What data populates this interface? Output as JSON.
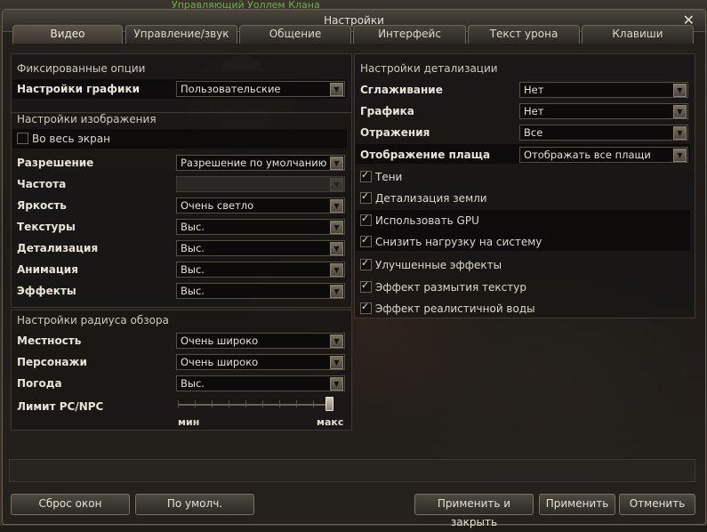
{
  "window": {
    "title": "Настройки",
    "background_caption": "Управляющий Уоллем Клана"
  },
  "tabs": [
    {
      "label": "Видео",
      "active": true
    },
    {
      "label": "Управление/звук",
      "active": false
    },
    {
      "label": "Общение",
      "active": false
    },
    {
      "label": "Интерфейс",
      "active": false
    },
    {
      "label": "Текст урона",
      "active": false
    },
    {
      "label": "Клавиши",
      "active": false
    }
  ],
  "left": {
    "fixed": {
      "title": "Фиксированные опции",
      "graphics_label": "Настройки графики",
      "graphics_value": "Пользовательские"
    },
    "image": {
      "title": "Настройки изображения",
      "fullscreen_label": "Во весь экран",
      "fullscreen_checked": false,
      "rows": [
        {
          "label": "Разрешение",
          "value": "Разрешение по умолчанию"
        },
        {
          "label": "Частота",
          "value": ""
        },
        {
          "label": "Яркость",
          "value": "Очень светло"
        },
        {
          "label": "Текстуры",
          "value": "Выс."
        },
        {
          "label": "Детализация",
          "value": "Выс."
        },
        {
          "label": "Анимация",
          "value": "Выс."
        },
        {
          "label": "Эффекты",
          "value": "Выс."
        }
      ]
    },
    "view": {
      "title": "Настройки радиуса обзора",
      "rows": [
        {
          "label": "Местность",
          "value": "Очень широко"
        },
        {
          "label": "Персонажи",
          "value": "Очень широко"
        },
        {
          "label": "Погода",
          "value": "Выс."
        }
      ],
      "pc_npc_label": "Лимит PC/NPC",
      "slider_level": 1.0,
      "slider_min_label": "мин",
      "slider_max_label": "макс"
    }
  },
  "right": {
    "title": "Настройки детализации",
    "rows": [
      {
        "label": "Сглаживание",
        "value": "Нет"
      },
      {
        "label": "Графика",
        "value": "Нет"
      },
      {
        "label": "Отражения",
        "value": "Все"
      },
      {
        "label": "Отображение плаща",
        "value": "Отображать все плащи"
      }
    ],
    "checks": [
      {
        "label": "Тени",
        "checked": true
      },
      {
        "label": "Детализация земли",
        "checked": true
      },
      {
        "label": "Использовать GPU",
        "checked": true
      },
      {
        "label": "Снизить нагрузку на систему",
        "checked": true
      },
      {
        "label": "Улучшенные эффекты",
        "checked": true
      },
      {
        "label": "Эффект размытия текстур",
        "checked": true
      },
      {
        "label": "Эффект реалистичной воды",
        "checked": true
      }
    ]
  },
  "buttons": {
    "reset_windows": "Сброс окон",
    "defaults": "По умолч.",
    "apply_close": "Применить и закрыть",
    "apply": "Применить",
    "cancel": "Отменить"
  }
}
